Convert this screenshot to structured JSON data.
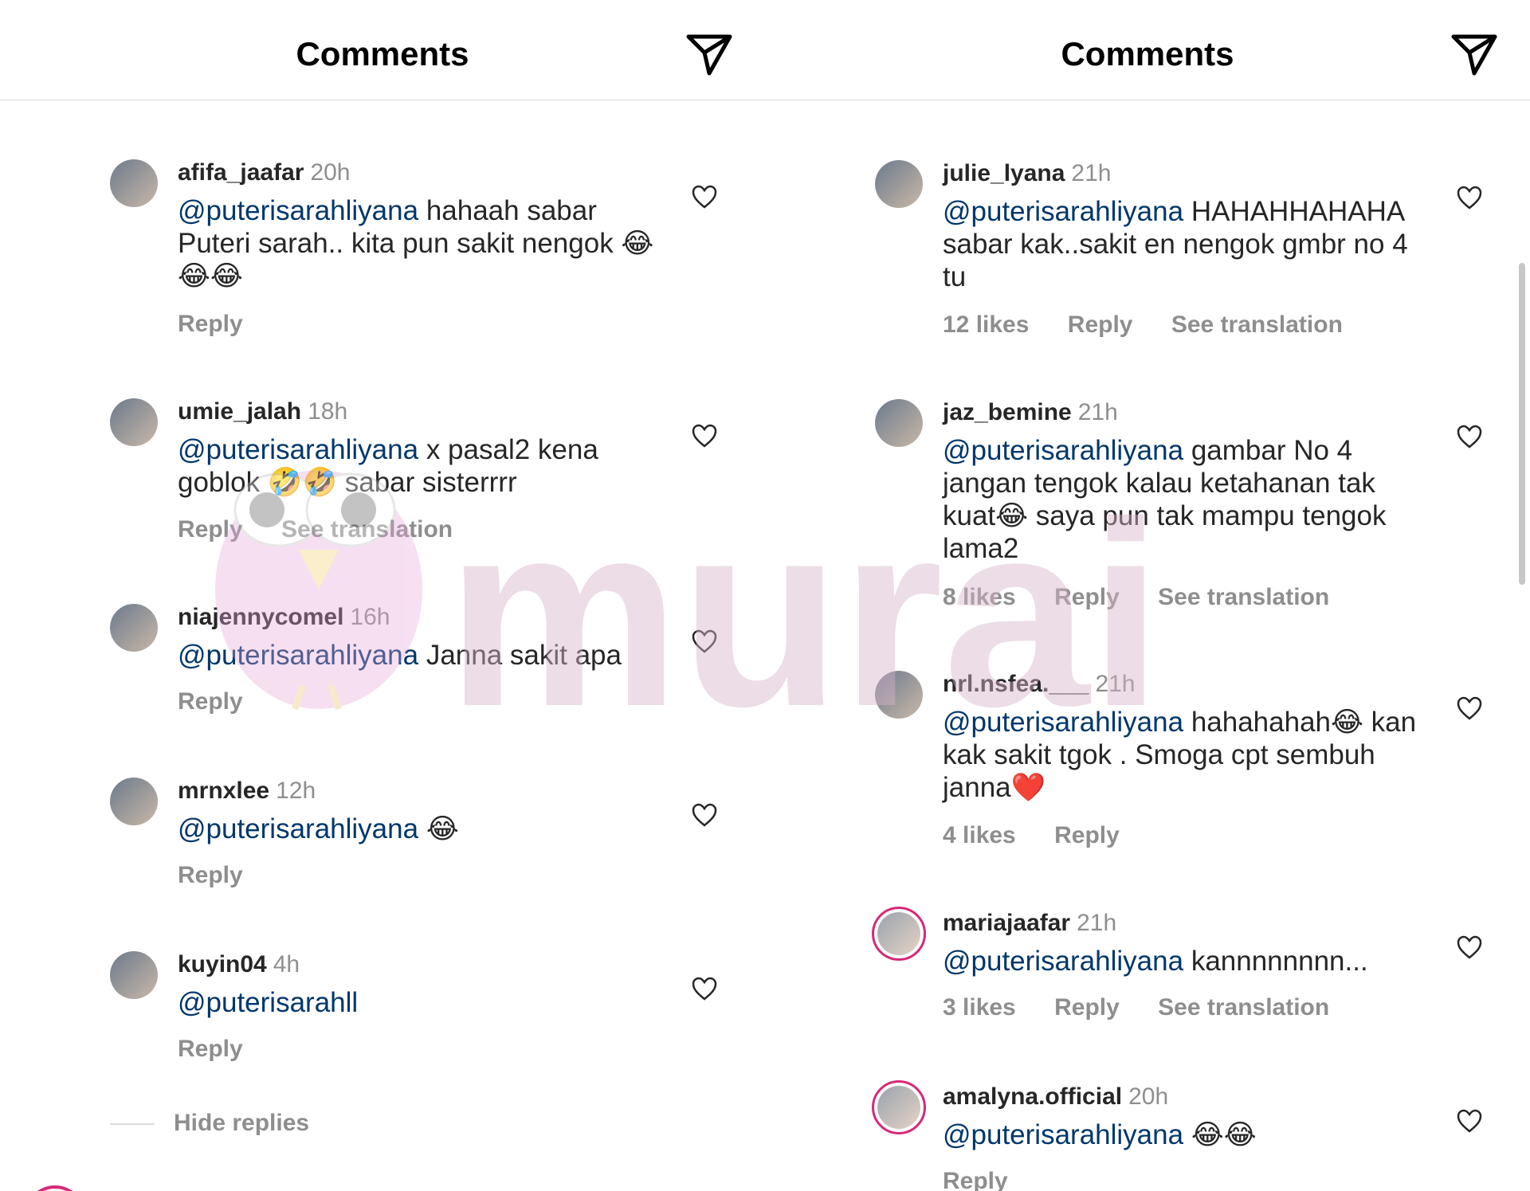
{
  "left": {
    "title": "Comments",
    "hide_replies": "Hide replies",
    "comments": [
      {
        "user": "afifa_jaafar",
        "time": "20h",
        "mention": "@puterisarahliyana",
        "text": " hahaah sabar Puteri sarah.. kita pun sakit nengok 😂😂😂",
        "actions": {
          "reply": "Reply"
        }
      },
      {
        "user": "umie_jalah",
        "time": "18h",
        "mention": "@puterisarahliyana",
        "text": " x pasal2 kena goblok 🤣🤣 sabar sisterrrr",
        "actions": {
          "reply": "Reply",
          "translate": "See translation"
        }
      },
      {
        "user": "niajennycomel",
        "time": "16h",
        "mention": "@puterisarahliyana",
        "text": " Janna sakit apa",
        "actions": {
          "reply": "Reply"
        }
      },
      {
        "user": "mrnxlee",
        "time": "12h",
        "mention": "@puterisarahliyana",
        "text": " 😂",
        "actions": {
          "reply": "Reply"
        }
      },
      {
        "user": "kuyin04",
        "time": "4h",
        "mention": "@puterisarahll",
        "text": "",
        "actions": {
          "reply": "Reply"
        }
      }
    ]
  },
  "right": {
    "title": "Comments",
    "comments": [
      {
        "user": "julie_lyana",
        "time": "21h",
        "mention": "@puterisarahliyana",
        "text": " HAHAHHAHAHA sabar kak..sakit en nengok gmbr no 4 tu",
        "actions": {
          "likes": "12 likes",
          "reply": "Reply",
          "translate": "See translation"
        }
      },
      {
        "user": "jaz_bemine",
        "time": "21h",
        "mention": "@puterisarahliyana",
        "text": " gambar No 4 jangan tengok kalau ketahanan tak kuat😂 saya pun tak mampu tengok lama2",
        "actions": {
          "likes": "8 likes",
          "reply": "Reply",
          "translate": "See translation"
        }
      },
      {
        "user": "nrl.nsfea.___",
        "time": "21h",
        "mention": "@puterisarahliyana",
        "text": " hahahahah😂 kan kak sakit tgok . Smoga cpt sembuh janna❤️",
        "actions": {
          "likes": "4 likes",
          "reply": "Reply"
        }
      },
      {
        "user": "mariajaafar",
        "time": "21h",
        "mention": "@puterisarahliyana",
        "text": " kannnnnnnn...",
        "actions": {
          "likes": "3 likes",
          "reply": "Reply",
          "translate": "See translation"
        }
      },
      {
        "user": "amalyna.official",
        "time": "20h",
        "mention": "@puterisarahliyana",
        "text": " 😂😂",
        "actions": {
          "reply": "Reply"
        }
      }
    ]
  },
  "watermark": "murai",
  "colors": {
    "mention": "#00376b",
    "muted": "#8e8e8e",
    "story_ring": "#d62976"
  },
  "icons": {
    "send": "paper-plane-icon",
    "like": "heart-outline-icon"
  }
}
